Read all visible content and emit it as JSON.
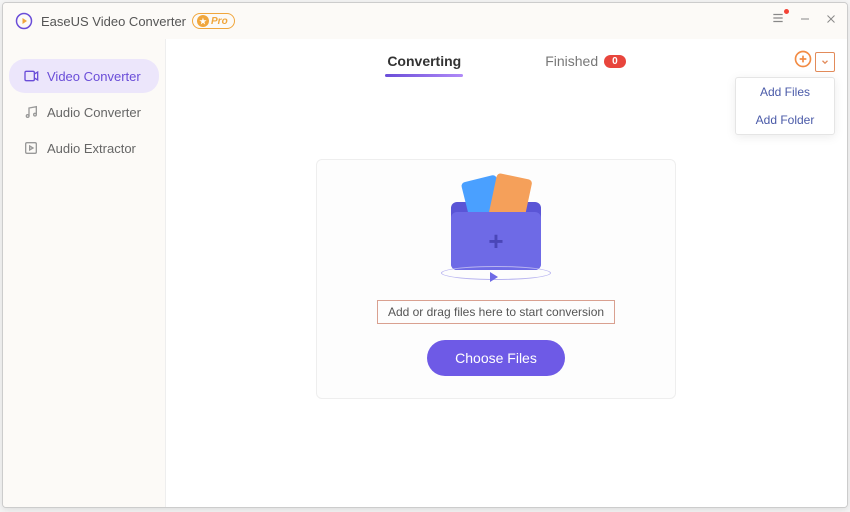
{
  "app": {
    "title": "EaseUS Video Converter",
    "pro_label": "Pro"
  },
  "sidebar": {
    "items": [
      {
        "label": "Video Converter",
        "active": true
      },
      {
        "label": "Audio Converter",
        "active": false
      },
      {
        "label": "Audio Extractor",
        "active": false
      }
    ]
  },
  "tabs": {
    "converting_label": "Converting",
    "finished_label": "Finished",
    "finished_count": "0"
  },
  "dropdown": {
    "add_files": "Add Files",
    "add_folder": "Add Folder"
  },
  "dropzone": {
    "hint": "Add or drag files here to start conversion",
    "button": "Choose Files"
  }
}
